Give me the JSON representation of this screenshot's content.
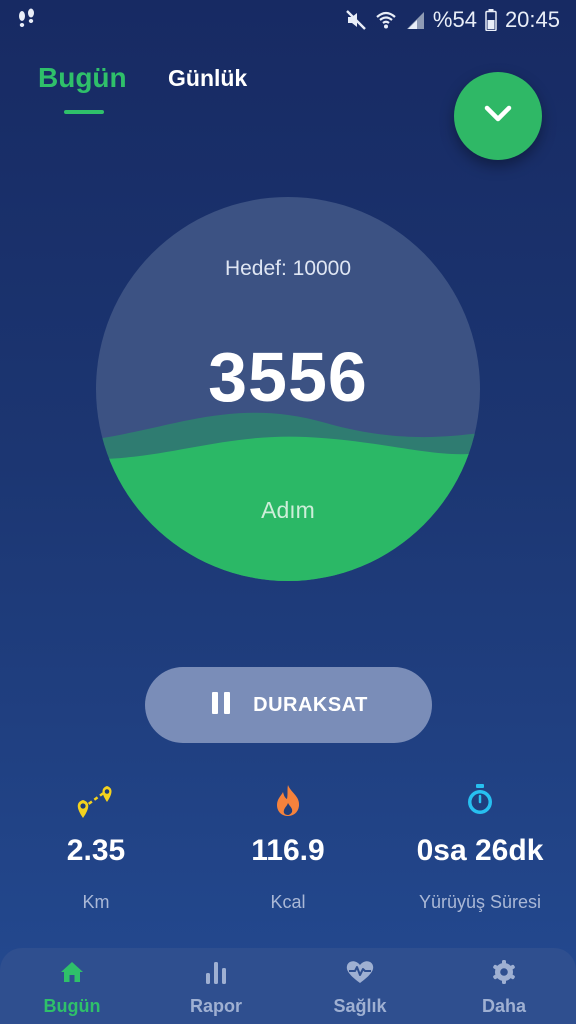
{
  "status_bar": {
    "battery": "%54",
    "time": "20:45"
  },
  "tabs": [
    {
      "label": "Bugün",
      "active": true
    },
    {
      "label": "Günlük",
      "active": false
    }
  ],
  "step_counter": {
    "goal": "Hedef: 10000",
    "steps": "3556",
    "unit": "Adım"
  },
  "pause_button": {
    "label": "DURAKSAT"
  },
  "stats": [
    {
      "icon": "route-icon",
      "value": "2.35",
      "label": "Km"
    },
    {
      "icon": "flame-icon",
      "value": "116.9",
      "label": "Kcal"
    },
    {
      "icon": "stopwatch-icon",
      "value": "0sa 26dk",
      "label": "Yürüyüş Süresi"
    }
  ],
  "bottom_nav": [
    {
      "icon": "home-icon",
      "label": "Bugün",
      "active": true
    },
    {
      "icon": "bar-chart-icon",
      "label": "Rapor",
      "active": false
    },
    {
      "icon": "heart-pulse-icon",
      "label": "Sağlık",
      "active": false
    },
    {
      "icon": "gear-icon",
      "label": "Daha",
      "active": false
    }
  ],
  "colors": {
    "accent": "#2fc06a",
    "background": "#1c3672"
  }
}
